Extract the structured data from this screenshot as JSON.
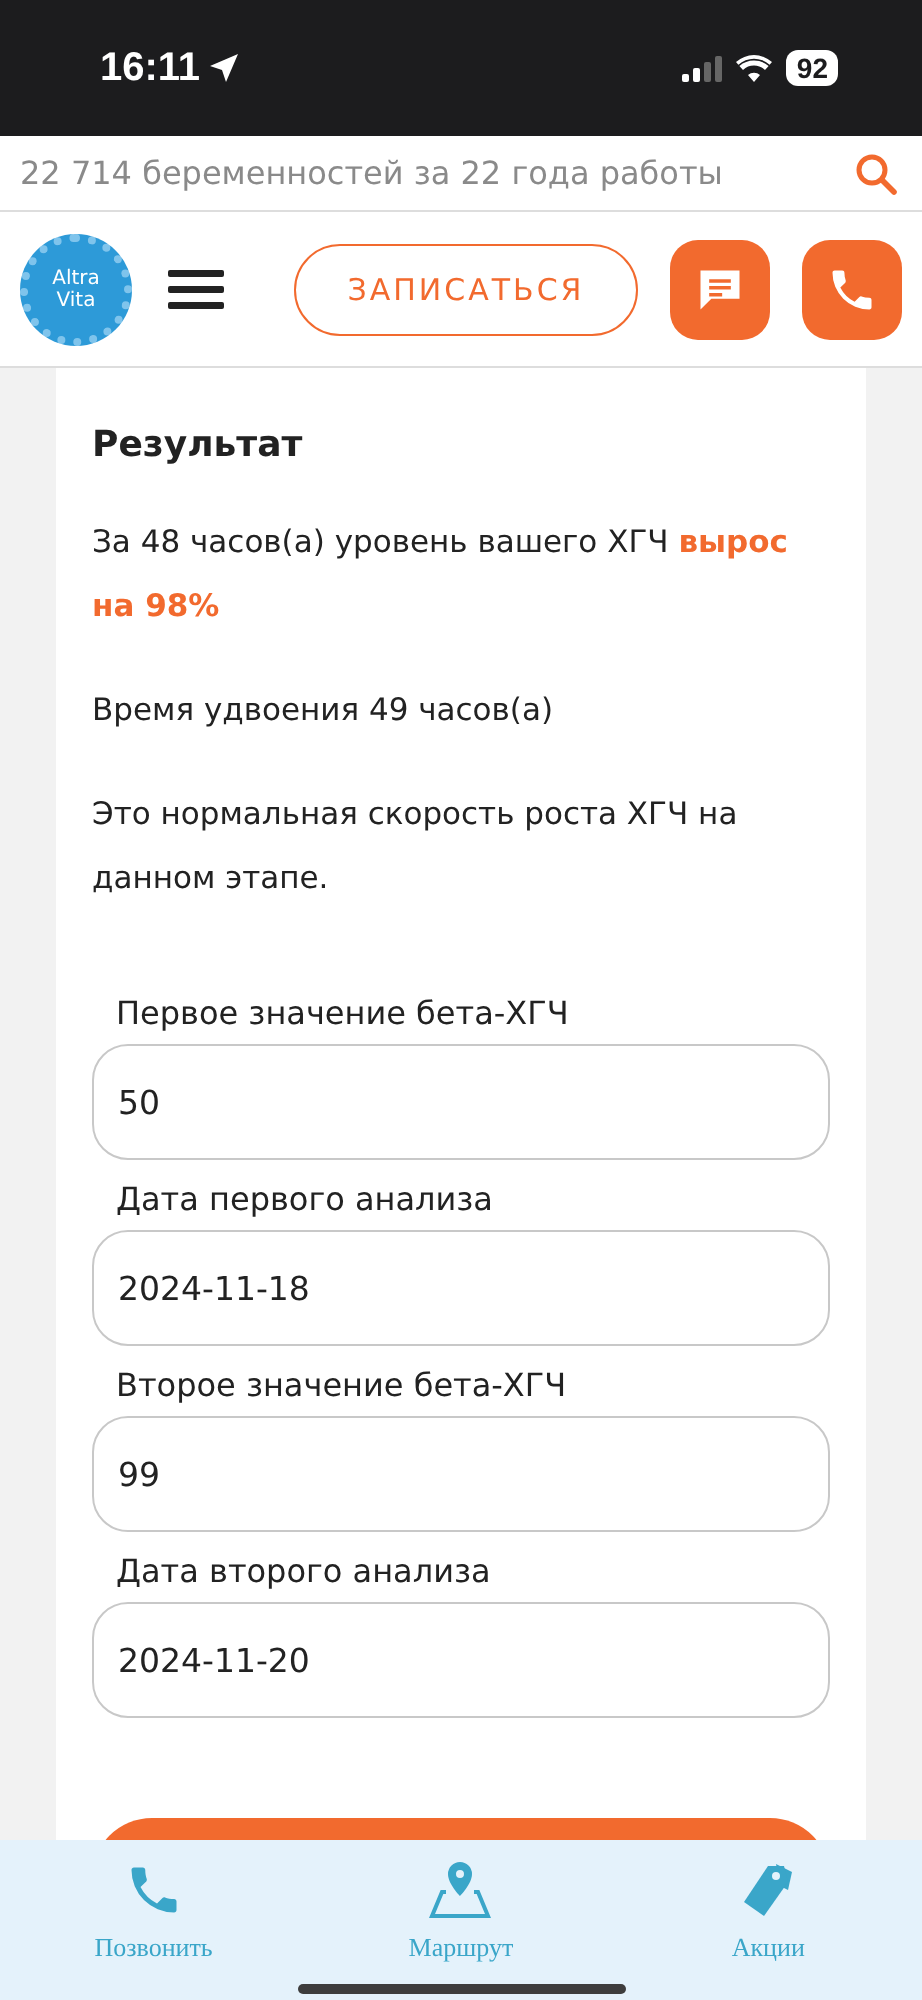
{
  "status_bar": {
    "time": "16:11",
    "battery": "92"
  },
  "info_bar": {
    "text": "22 714 беременностей за 22 года работы"
  },
  "header": {
    "signup_button": "ЗАПИСАТЬСЯ",
    "logo_words": [
      "Altra",
      "Vita"
    ]
  },
  "result": {
    "title": "Результат",
    "paragraphs": [
      {
        "text": "За 48 часов(а) уровень вашего ХГЧ ",
        "highlight": "вырос на 98%"
      },
      {
        "text": "Время удвоения 49 часов(а)"
      },
      {
        "text": "Это нормальная скорость роста ХГЧ на данном этапе."
      }
    ]
  },
  "fields": [
    {
      "label": "Первое значение бета-ХГЧ",
      "value": "50"
    },
    {
      "label": "Дата первого анализа",
      "value": "2024-11-18"
    },
    {
      "label": "Второе значение бета-ХГЧ",
      "value": "99"
    },
    {
      "label": "Дата второго анализа",
      "value": "2024-11-20"
    }
  ],
  "bottom_nav": [
    {
      "kind": "call",
      "label": "Позвонить"
    },
    {
      "kind": "route",
      "label": "Маршрут"
    },
    {
      "kind": "sales",
      "label": "Акции"
    }
  ]
}
